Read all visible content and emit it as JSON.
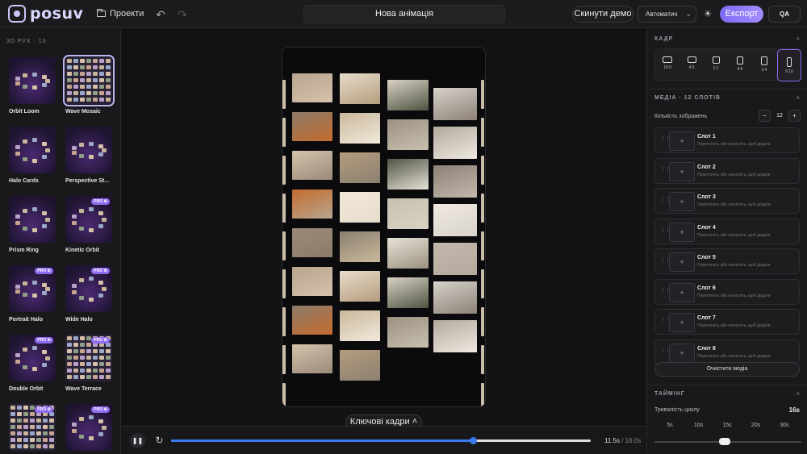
{
  "app": {
    "logo_text": "posuv"
  },
  "topbar": {
    "projects_label": "Проекти",
    "title": "Нова анімація",
    "reset_demo_label": "Скинути демо",
    "mode_select_value": "Автоматич",
    "export_label": "Експорт",
    "qa_label": "QA"
  },
  "templates": {
    "heading": "3D РУХ · 13",
    "pro_badge": "PRO ⚙",
    "items": [
      {
        "name": "Orbit Loom",
        "pro": false,
        "selected": false
      },
      {
        "name": "Wave Mosaic",
        "pro": false,
        "selected": true
      },
      {
        "name": "Halo Cards",
        "pro": false,
        "selected": false
      },
      {
        "name": "Perspective St...",
        "pro": false,
        "selected": false
      },
      {
        "name": "Prism Ring",
        "pro": false,
        "selected": false
      },
      {
        "name": "Kinetic Orbit",
        "pro": true,
        "selected": false
      },
      {
        "name": "Portrait Halo",
        "pro": true,
        "selected": false
      },
      {
        "name": "Wide Halo",
        "pro": true,
        "selected": false
      },
      {
        "name": "Double Orbit",
        "pro": true,
        "selected": false
      },
      {
        "name": "Wave Terrace",
        "pro": true,
        "selected": false
      },
      {
        "name": "",
        "pro": true,
        "selected": false
      },
      {
        "name": "",
        "pro": true,
        "selected": false
      }
    ]
  },
  "canvas": {
    "keyframes_label": "Ключові кадри"
  },
  "playback": {
    "state": "playing",
    "current_time": "11.5s",
    "total_time": "16.0s",
    "progress": 0.72
  },
  "frame": {
    "heading": "КАДР",
    "ratios": [
      {
        "label": "16:9",
        "selected": false
      },
      {
        "label": "4:3",
        "selected": false
      },
      {
        "label": "1:1",
        "selected": false
      },
      {
        "label": "4:5",
        "selected": false
      },
      {
        "label": "3:4",
        "selected": false
      },
      {
        "label": "9:16",
        "selected": true
      }
    ]
  },
  "media": {
    "heading": "МЕДІА · 12 СЛОТІВ",
    "count_label": "Кількість зображень",
    "count_value": "12",
    "minus": "−",
    "plus": "+",
    "slot_hint": "Перетягніть або натисніть, щоб додати",
    "slots": [
      "Слот 1",
      "Слот 2",
      "Слот 3",
      "Слот 4",
      "Слот 5",
      "Слот 6",
      "Слот 7",
      "Слот 8"
    ],
    "clear_label": "Очистити медіа"
  },
  "timing": {
    "heading": "ТАЙМІНГ",
    "duration_label": "Тривалість циклу",
    "duration_value": "16s",
    "options": [
      "5s",
      "10s",
      "15s",
      "20s",
      "30s"
    ]
  },
  "colors": {
    "accent": "#8f6bf0",
    "progress": "#3b7bf0"
  }
}
